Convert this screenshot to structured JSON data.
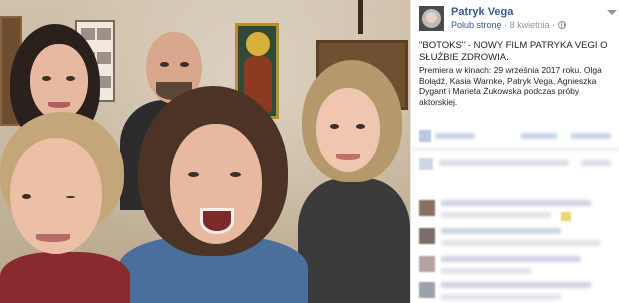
{
  "post": {
    "author": "Patryk Vega",
    "like_page": "Polub stronę",
    "separator": "·",
    "date": "8 kwietnia",
    "title": "\"BOTOKS\" - NOWY FILM PATRYKA VEGI O SŁUŻBIE ZDROWIA.",
    "body": "Premiera w kinach: 29 września 2017 roku. Olga Bołądź, Kasia Warnke, Patryk Vega, Agnieszka Dygant i Marieta Żukowska podczas próby aktorskiej.",
    "icons": {
      "privacy": "globe-icon",
      "menu": "caret-down-icon"
    }
  },
  "photo": {
    "subject": "group-selfie-photo"
  },
  "colors": {
    "link": "#365899",
    "meta": "#90949c",
    "text": "#1d2129",
    "border": "#e5e6e9"
  }
}
